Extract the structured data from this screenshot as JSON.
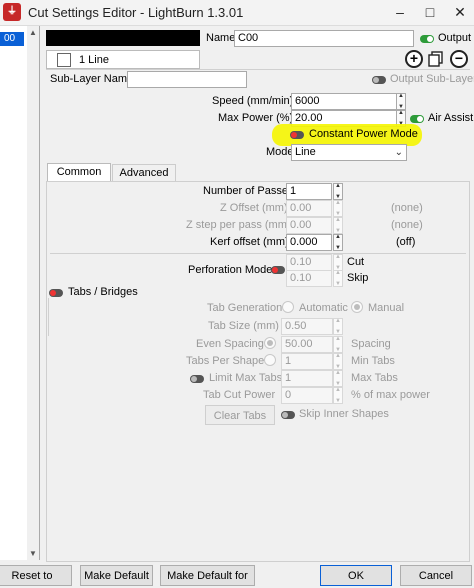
{
  "window": {
    "title": "Cut Settings Editor - LightBurn 1.3.01",
    "logo": "lightburn-logo",
    "minimize": "–",
    "maximize": "□",
    "close": "✕"
  },
  "layers": {
    "selected": "00"
  },
  "header": {
    "name_label": "Name",
    "name_value": "C00",
    "output_label": "Output",
    "output_on": true
  },
  "sublayer": {
    "tab_label": "1 Line",
    "name_label": "Sub-Layer Name",
    "name_value": "",
    "output_label": "Output Sub-Layer",
    "add": "+",
    "remove": "−"
  },
  "speed": {
    "label": "Speed (mm/min)",
    "value": "6000"
  },
  "power": {
    "label": "Max Power (%)",
    "value": "20.00"
  },
  "air_assist": {
    "label": "Air Assist",
    "on": true
  },
  "constant_power": {
    "label": "Constant Power Mode",
    "on": false
  },
  "mode": {
    "label": "Mode",
    "value": "Line"
  },
  "tabs": [
    {
      "label": "Common"
    },
    {
      "label": "Advanced"
    }
  ],
  "common": {
    "passes": {
      "label": "Number of Passes",
      "value": "1"
    },
    "z_offset": {
      "label": "Z Offset (mm)",
      "value": "0.00",
      "note": "(none)"
    },
    "z_step": {
      "label": "Z step per pass (mm)",
      "value": "0.00",
      "note": "(none)"
    },
    "kerf": {
      "label": "Kerf offset (mm)",
      "value": "0.000",
      "note": "(off)"
    }
  },
  "perforation": {
    "label": "Perforation Mode",
    "cut_value": "0.10",
    "cut_label": "Cut",
    "skip_value": "0.10",
    "skip_label": "Skip"
  },
  "tabs_bridges": {
    "label": "Tabs / Bridges",
    "generation_label": "Tab Generation",
    "automatic": "Automatic",
    "manual": "Manual",
    "size_label": "Tab Size (mm)",
    "size_value": "0.50",
    "even_label": "Even Spacing",
    "even_value": "50.00",
    "spacing_label": "Spacing",
    "per_shape_label": "Tabs Per Shape",
    "per_shape_value": "1",
    "min_tabs_label": "Min Tabs",
    "limit_label": "Limit Max Tabs",
    "limit_value": "1",
    "max_tabs_label": "Max Tabs",
    "cut_power_label": "Tab Cut Power",
    "cut_power_value": "0",
    "cut_power_unit": "% of max power",
    "clear_tabs": "Clear Tabs",
    "skip_inner": "Skip Inner Shapes"
  },
  "footer": {
    "reset": "Reset to Default",
    "make_default": "Make Default",
    "make_default_all": "Make Default for All",
    "ok": "OK",
    "cancel": "Cancel"
  }
}
